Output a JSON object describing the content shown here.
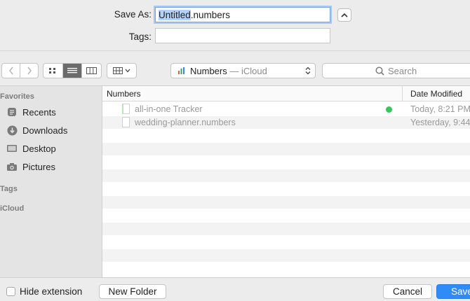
{
  "save_as": {
    "label": "Save As:",
    "value_selected": "Untitled",
    "value_rest": ".numbers"
  },
  "tags": {
    "label": "Tags:",
    "value": ""
  },
  "toolbar": {
    "location_name": "Numbers",
    "location_sub": " — iCloud",
    "search_placeholder": "Search"
  },
  "sidebar": {
    "favorites_heading": "Favorites",
    "items": [
      {
        "label": "Recents",
        "icon": "clock-icon"
      },
      {
        "label": "Downloads",
        "icon": "download-icon"
      },
      {
        "label": "Desktop",
        "icon": "desktop-icon"
      },
      {
        "label": "Pictures",
        "icon": "camera-icon"
      }
    ],
    "tags_heading": "Tags",
    "icloud_heading": "iCloud"
  },
  "filelist": {
    "col_name": "Numbers",
    "col_date": "Date Modified",
    "rows": [
      {
        "name": "all-in-one Tracker",
        "date": "Today, 8:21 PM",
        "synced": true
      },
      {
        "name": "wedding-planner.numbers",
        "date": "Yesterday, 9:44",
        "synced": false
      }
    ]
  },
  "bottom": {
    "hide_extension": "Hide extension",
    "new_folder": "New Folder",
    "cancel": "Cancel",
    "save": "Save"
  },
  "colors": {
    "accent": "#2f8bf5",
    "selection": "#b3d2f6",
    "status_green": "#35c759"
  }
}
